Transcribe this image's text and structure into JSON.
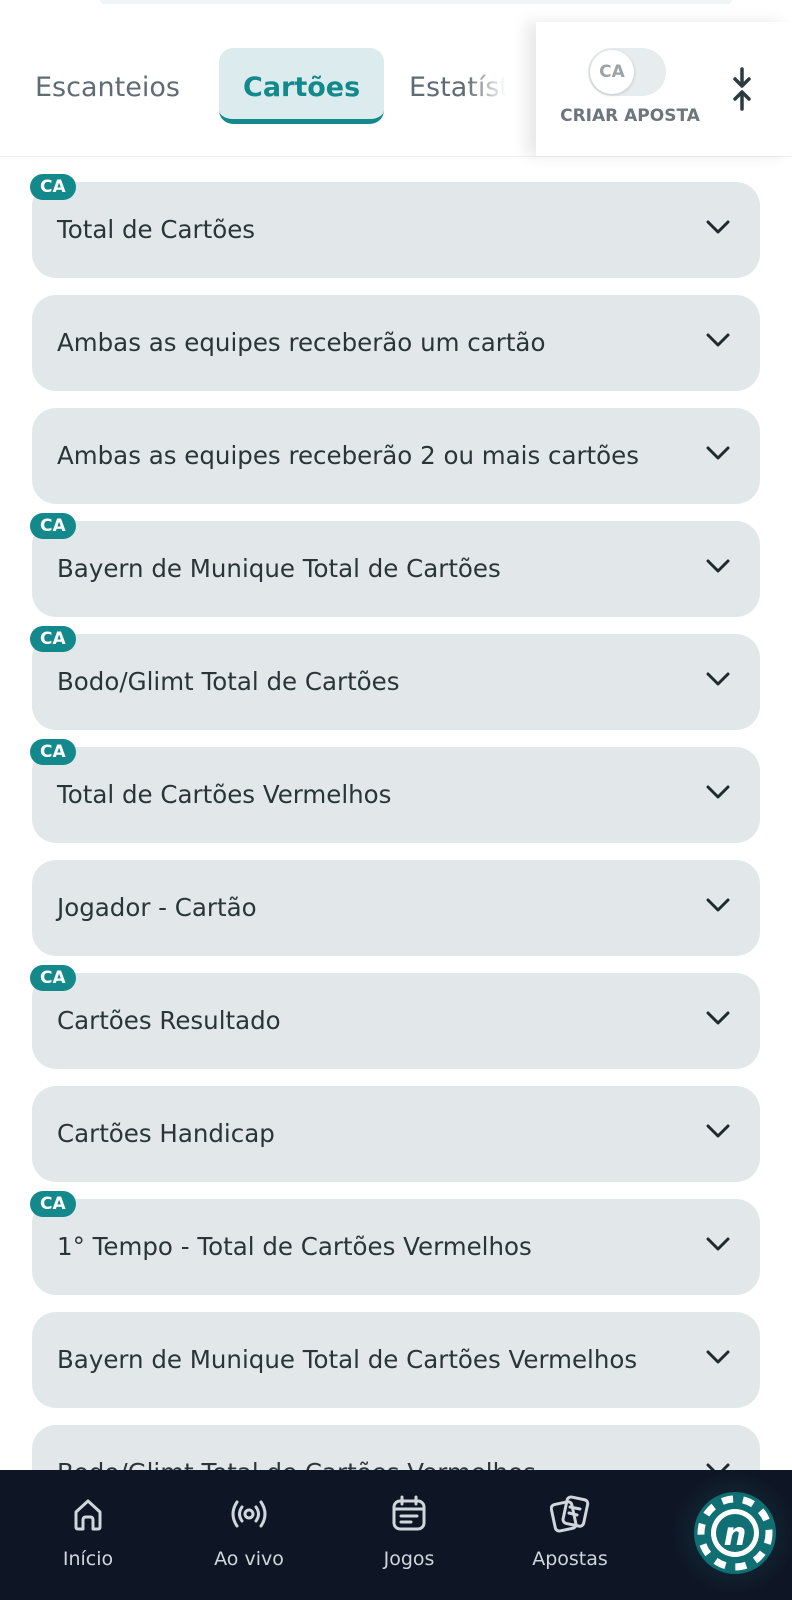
{
  "tabs": [
    "Escanteios",
    "Cartões",
    "Estatíst"
  ],
  "active_tab": "Cartões",
  "bet_builder": {
    "toggle_label": "CA",
    "label": "CRIAR APOSTA"
  },
  "markets": [
    {
      "title": "Total de Cartões",
      "badge": "CA"
    },
    {
      "title": "Ambas as equipes receberão um cartão",
      "badge": ""
    },
    {
      "title": "Ambas as equipes receberão 2 ou mais cartões",
      "badge": ""
    },
    {
      "title": "Bayern de Munique Total de Cartões",
      "badge": "CA"
    },
    {
      "title": "Bodo/Glimt Total de Cartões",
      "badge": "CA"
    },
    {
      "title": "Total de Cartões Vermelhos",
      "badge": "CA"
    },
    {
      "title": "Jogador - Cartão",
      "badge": ""
    },
    {
      "title": "Cartões Resultado",
      "badge": "CA"
    },
    {
      "title": "Cartões Handicap",
      "badge": ""
    },
    {
      "title": "1° Tempo - Total de Cartões Vermelhos",
      "badge": "CA"
    },
    {
      "title": "Bayern de Munique Total de Cartões Vermelhos",
      "badge": ""
    },
    {
      "title": "Bodo/Glimt Total de Cartões Vermelhos",
      "badge": ""
    }
  ],
  "bottom_nav": [
    {
      "label": "Início",
      "icon": "home-icon"
    },
    {
      "label": "Ao vivo",
      "icon": "live-icon"
    },
    {
      "label": "Jogos",
      "icon": "calendar-icon"
    },
    {
      "label": "Apostas",
      "icon": "bets-icon"
    }
  ],
  "brand_chip": {
    "letter": "n"
  },
  "colors": {
    "accent": "#13898b",
    "card_bg": "#e2e8ea",
    "nav_bg": "#0e1524"
  }
}
